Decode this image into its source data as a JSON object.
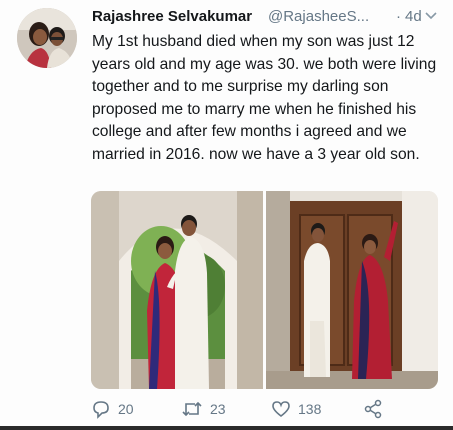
{
  "tweet": {
    "author_name": "Rajashree Selvakumar",
    "handle": "@RajasheeS...",
    "separator": "·",
    "time": "4d",
    "text": "My 1st husband died when my son was just 12 years old and my age was 30. we both were living together and to me surprise my darling son proposed me to marry me when he finished his college and after few months i agreed and we married in 2016. now we have a 3 year old son."
  },
  "actions": {
    "reply_count": "20",
    "retweet_count": "23",
    "like_count": "138"
  },
  "colors": {
    "text": "#14171a",
    "secondary": "#657786"
  },
  "icons": [
    "avatar",
    "chevron-down-icon",
    "reply-icon",
    "retweet-icon",
    "like-icon",
    "share-icon"
  ]
}
